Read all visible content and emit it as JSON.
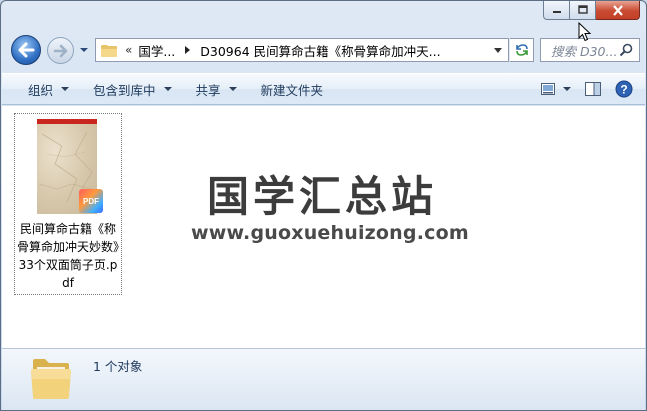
{
  "window": {
    "caption": {
      "minimize": "minimize",
      "maximize": "maximize",
      "close": "close"
    }
  },
  "nav": {
    "address": {
      "chevron": "«",
      "segment1": "国学...",
      "segment2": "D30964 民间算命古籍《称骨算命加冲天..."
    },
    "search": {
      "placeholder": "搜索 D30..."
    }
  },
  "commandbar": {
    "organize": "组织",
    "include_in_library": "包含到库中",
    "share": "共享",
    "new_folder": "新建文件夹"
  },
  "content": {
    "file": {
      "name": "民间算命古籍《称骨算命加冲天妙数》33个双面筒子页.pdf",
      "badge": "PDF"
    },
    "watermark": {
      "title": "国学汇总站",
      "url": "www.guoxuehuizong.com"
    }
  },
  "details": {
    "count": "1 个对象"
  },
  "colors": {
    "accent": "#1e395b",
    "close_button": "#c94a32",
    "pdf_top": "#c8261e"
  },
  "icons": [
    "back-arrow-icon",
    "forward-arrow-icon",
    "folder-icon",
    "refresh-icon",
    "search-icon",
    "view-options-icon",
    "preview-pane-icon",
    "help-icon",
    "pdf-icon",
    "cursor-icon"
  ]
}
